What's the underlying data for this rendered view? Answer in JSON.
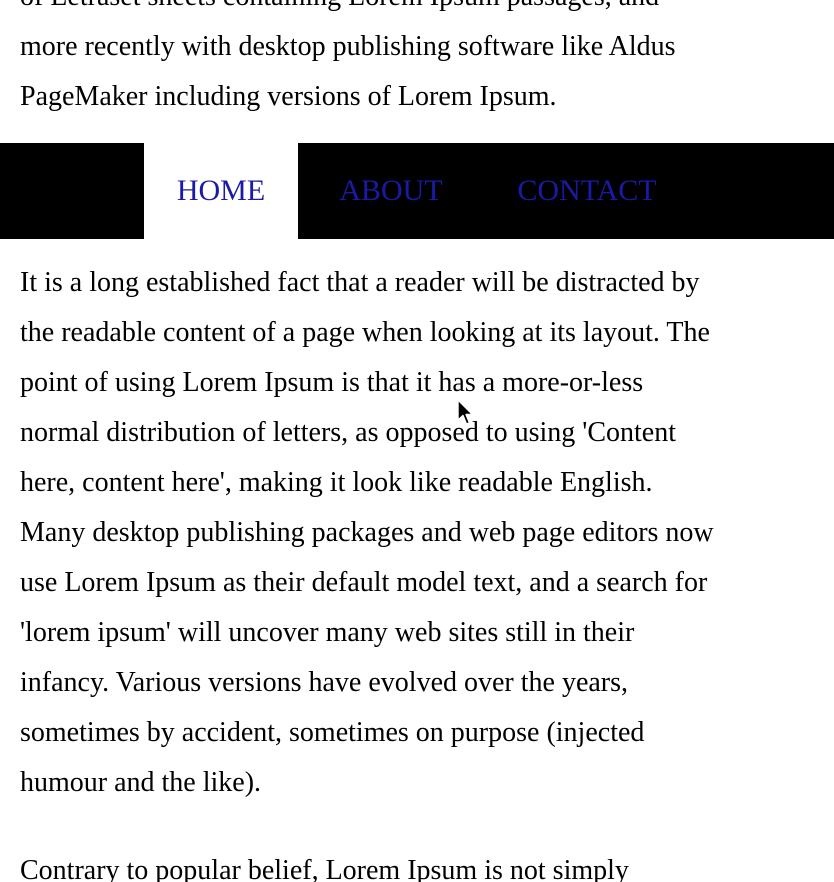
{
  "paragraphs": {
    "top": [
      "of Letraset sheets containing Lorem Ipsum passages, and",
      "more recently with desktop publishing software like Aldus",
      "PageMaker including versions of Lorem Ipsum."
    ],
    "main": [
      "It is a long established fact that a reader will be distracted by",
      "the readable content of a page when looking at its layout. The",
      "point of using Lorem Ipsum is that it has a more-or-less",
      "normal distribution of letters, as opposed to using 'Content",
      "here, content here', making it look like readable English.",
      "Many desktop publishing packages and web page editors now",
      "use Lorem Ipsum as their default model text, and a search for",
      "'lorem ipsum' will uncover many web sites still in their",
      "infancy. Various versions have evolved over the years,",
      "sometimes by accident, sometimes on purpose (injected",
      "humour and the like)."
    ],
    "bottom": [
      "Contrary to popular belief, Lorem Ipsum is not simply"
    ]
  },
  "nav": {
    "home": "HOME",
    "about": "ABOUT",
    "contact": "CONTACT",
    "active": "home"
  },
  "colors": {
    "nav_background": "#000000",
    "nav_link": "#1a1aa6",
    "active_tab_background": "#ffffff"
  },
  "icons": {
    "cursor": "mouse-pointer-icon"
  }
}
